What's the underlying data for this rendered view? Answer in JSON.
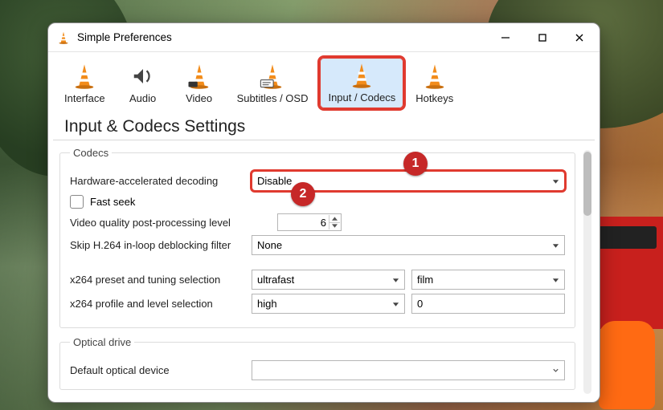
{
  "window": {
    "title": "Simple Preferences"
  },
  "tabs": {
    "interface": "Interface",
    "audio": "Audio",
    "video": "Video",
    "subtitles": "Subtitles / OSD",
    "input_codecs": "Input / Codecs",
    "hotkeys": "Hotkeys",
    "active": "input_codecs"
  },
  "heading": "Input & Codecs Settings",
  "callouts": {
    "one": "1",
    "two": "2"
  },
  "groups": {
    "codecs": {
      "legend": "Codecs",
      "hw_decoding_label": "Hardware-accelerated decoding",
      "hw_decoding_value": "Disable",
      "fast_seek_label": "Fast seek",
      "fast_seek_checked": false,
      "postproc_label": "Video quality post-processing level",
      "postproc_value": "6",
      "skip_deblock_label": "Skip H.264 in-loop deblocking filter",
      "skip_deblock_value": "None",
      "x264_preset_label": "x264 preset and tuning selection",
      "x264_preset_value": "ultrafast",
      "x264_tuning_value": "film",
      "x264_profile_label": "x264 profile and level selection",
      "x264_profile_value": "high",
      "x264_level_value": "0"
    },
    "optical": {
      "legend": "Optical drive",
      "default_device_label": "Default optical device",
      "default_device_value": ""
    }
  }
}
